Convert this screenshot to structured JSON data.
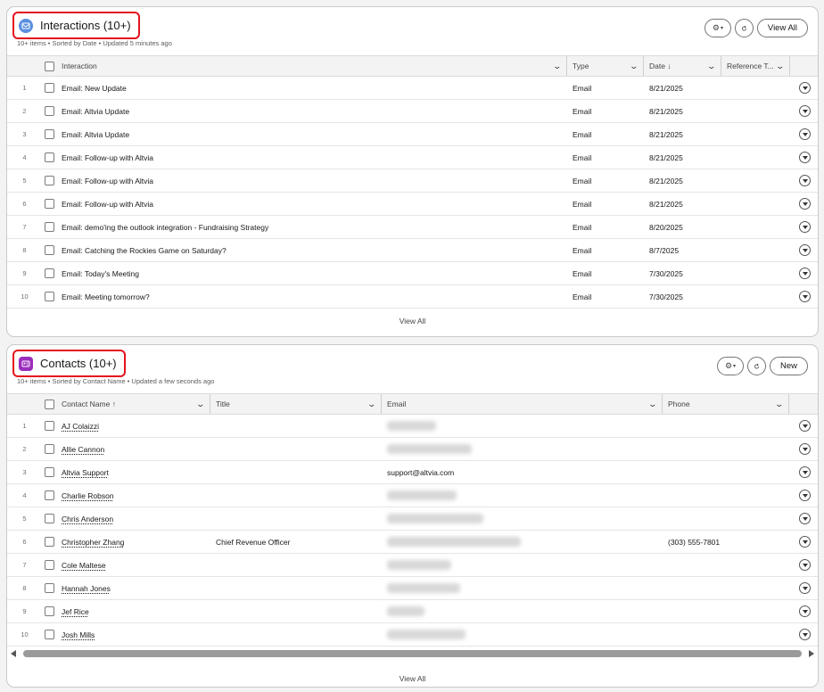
{
  "interactions": {
    "title": "Interactions (10+)",
    "subtitle": "10+ items • Sorted by Date • Updated 5 minutes ago",
    "icon_color": "#5a8fe0",
    "view_all_btn": "View All",
    "columns": [
      "Interaction",
      "Type",
      "Date ↓",
      "Reference T..."
    ],
    "rows": [
      {
        "num": "1",
        "interaction": "Email: New Update",
        "type": "Email",
        "date": "8/21/2025"
      },
      {
        "num": "2",
        "interaction": "Email: Altvia Update",
        "type": "Email",
        "date": "8/21/2025"
      },
      {
        "num": "3",
        "interaction": "Email: Altvia Update",
        "type": "Email",
        "date": "8/21/2025"
      },
      {
        "num": "4",
        "interaction": "Email: Follow-up with Altvia",
        "type": "Email",
        "date": "8/21/2025"
      },
      {
        "num": "5",
        "interaction": "Email: Follow-up with Altvia",
        "type": "Email",
        "date": "8/21/2025"
      },
      {
        "num": "6",
        "interaction": "Email: Follow-up with Altvia",
        "type": "Email",
        "date": "8/21/2025"
      },
      {
        "num": "7",
        "interaction": "Email: demo'ing the outlook integration - Fundraising Strategy",
        "type": "Email",
        "date": "8/20/2025"
      },
      {
        "num": "8",
        "interaction": "Email: Catching the Rockies Game on Saturday?",
        "type": "Email",
        "date": "8/7/2025"
      },
      {
        "num": "9",
        "interaction": "Email: Today's Meeting",
        "type": "Email",
        "date": "7/30/2025"
      },
      {
        "num": "10",
        "interaction": "Email: Meeting tomorrow?",
        "type": "Email",
        "date": "7/30/2025"
      }
    ],
    "footer": "View All"
  },
  "contacts": {
    "title": "Contacts (10+)",
    "subtitle": "10+ items • Sorted by Contact Name • Updated a few seconds ago",
    "icon_color": "#9b2ebd",
    "new_btn": "New",
    "columns": [
      "Contact Name ↑",
      "Title",
      "Email",
      "Phone"
    ],
    "rows": [
      {
        "num": "1",
        "name": "AJ Colaizzi",
        "title": "",
        "email": "",
        "phone": ""
      },
      {
        "num": "2",
        "name": "Allie Cannon",
        "title": "",
        "email": "",
        "phone": ""
      },
      {
        "num": "3",
        "name": "Altvia Support",
        "title": "",
        "email": "support@altvia.com",
        "phone": ""
      },
      {
        "num": "4",
        "name": "Charlie Robson",
        "title": "",
        "email": "",
        "phone": ""
      },
      {
        "num": "5",
        "name": "Chris Anderson",
        "title": "",
        "email": "",
        "phone": ""
      },
      {
        "num": "6",
        "name": "Christopher Zhang",
        "title": "Chief Revenue Officer",
        "email": "",
        "phone": "(303) 555-7801"
      },
      {
        "num": "7",
        "name": "Cole Maltese",
        "title": "",
        "email": "",
        "phone": ""
      },
      {
        "num": "8",
        "name": "Hannah Jones",
        "title": "",
        "email": "",
        "phone": ""
      },
      {
        "num": "9",
        "name": "Jef Rice",
        "title": "",
        "email": "",
        "phone": ""
      },
      {
        "num": "10",
        "name": "Josh Mills",
        "title": "",
        "email": "",
        "phone": ""
      }
    ],
    "footer": "View All"
  }
}
